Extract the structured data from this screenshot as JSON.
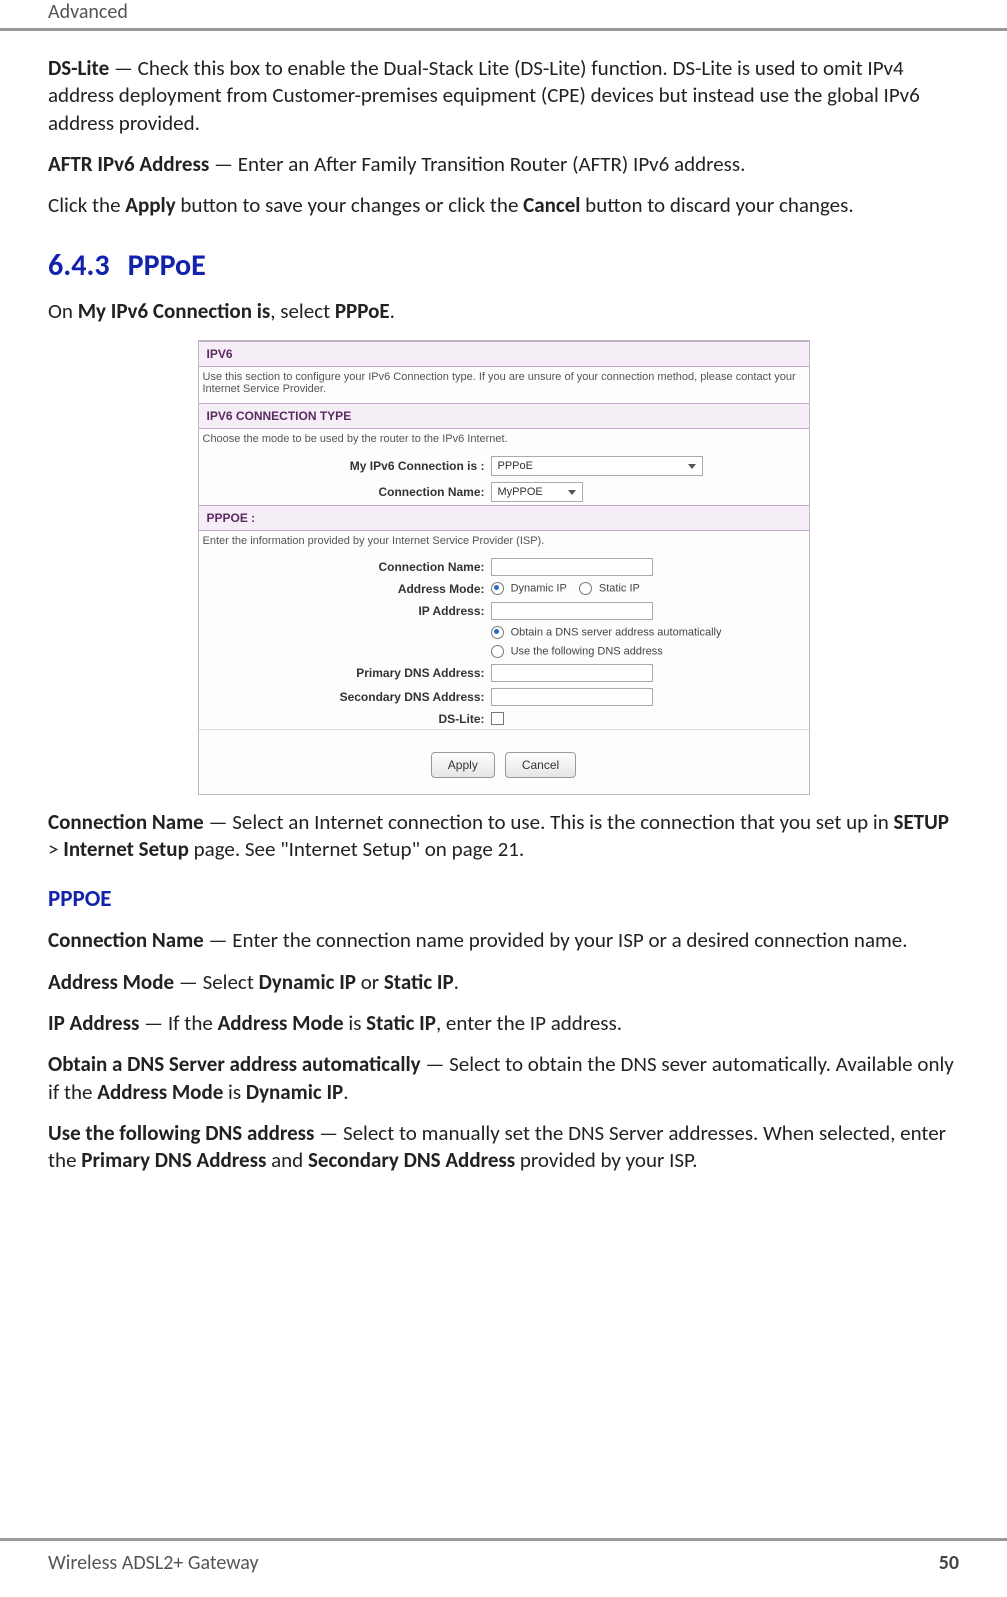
{
  "header": {
    "title": "Advanced"
  },
  "intro": {
    "dslite_term": "DS-Lite",
    "dslite_desc": " — Check this box to enable the Dual-Stack Lite (DS-Lite) function. DS-Lite is used to omit IPv4 address deployment from Customer-premises equipment (CPE) devices but instead use the global IPv6 address provided.",
    "aftr_term": "AFTR IPv6 Address",
    "aftr_desc": " — Enter an After Family Transition Router (AFTR) IPv6 address.",
    "click_pre": "Click the ",
    "apply_b": "Apply",
    "click_mid": " button to save your changes or click the ",
    "cancel_b": "Cancel",
    "click_post": " button to discard your changes."
  },
  "section": {
    "num": "6.4.3",
    "title": "PPPoE",
    "on_pre": "On ",
    "on_b1": "My IPv6 Connection is",
    "on_mid": ", select ",
    "on_b2": "PPPoE",
    "on_post": "."
  },
  "panel": {
    "ipv6_h": "IPV6",
    "ipv6_desc": "Use this section to configure your IPv6 Connection type. If you are unsure of your connection method, please contact your Internet Service Provider.",
    "conntype_h": "IPV6 CONNECTION TYPE",
    "conntype_desc": "Choose the mode to be used by the router to the IPv6 Internet.",
    "row_myconn_lbl": "My IPv6 Connection is :",
    "row_myconn_val": "PPPoE",
    "row_connname_lbl": "Connection Name:",
    "row_connname_val": "MyPPOE",
    "pppoe_h": "PPPOE :",
    "pppoe_desc": "Enter the information provided by your Internet Service Provider (ISP).",
    "fr_connname": "Connection Name:",
    "fr_addrmode": "Address Mode:",
    "opt_dyn": "Dynamic IP",
    "opt_static": "Static IP",
    "fr_ip": "IP Address:",
    "opt_obtain": "Obtain a DNS server address automatically",
    "opt_usefollow": "Use the following DNS address",
    "fr_pdns": "Primary DNS Address:",
    "fr_sdns": "Secondary DNS Address:",
    "fr_dslite": "DS-Lite:",
    "btn_apply": "Apply",
    "btn_cancel": "Cancel"
  },
  "below": {
    "cn_term": "Connection Name",
    "cn_desc_pre": " — Select an Internet connection to use. This is the connection that you set up in ",
    "cn_b1": "SETUP",
    "cn_gt": " > ",
    "cn_b2": "Internet Setup",
    "cn_desc_post": " page. See \"Internet Setup\" on page 21.",
    "pppoe_title": "PPPOE",
    "p_cn_term": "Connection Name",
    "p_cn_desc": " — Enter the connection name provided by your ISP or a desired connection name.",
    "p_am_term": "Address Mode",
    "p_am_pre": " — Select ",
    "p_am_b1": "Dynamic IP",
    "p_am_or": " or ",
    "p_am_b2": "Static IP",
    "p_am_post": ".",
    "p_ip_term": "IP Address",
    "p_ip_pre": " — If the ",
    "p_ip_b1": "Address Mode",
    "p_ip_mid": " is ",
    "p_ip_b2": "Static IP",
    "p_ip_post": ", enter the IP address.",
    "p_obt_term": "Obtain a DNS Server address automatically",
    "p_obt_pre": " — Select to obtain the DNS sever automatically. Available only if the ",
    "p_obt_b1": "Address Mode",
    "p_obt_mid": " is ",
    "p_obt_b2": "Dynamic IP",
    "p_obt_post": ".",
    "p_use_term": "Use the following DNS address",
    "p_use_pre": " — Select to manually set the DNS Server addresses. When selected, enter the ",
    "p_use_b1": "Primary DNS Address",
    "p_use_and": " and ",
    "p_use_b2": "Secondary DNS Address",
    "p_use_post": " provided by your ISP."
  },
  "footer": {
    "product": "Wireless ADSL2+ Gateway",
    "page": "50"
  }
}
